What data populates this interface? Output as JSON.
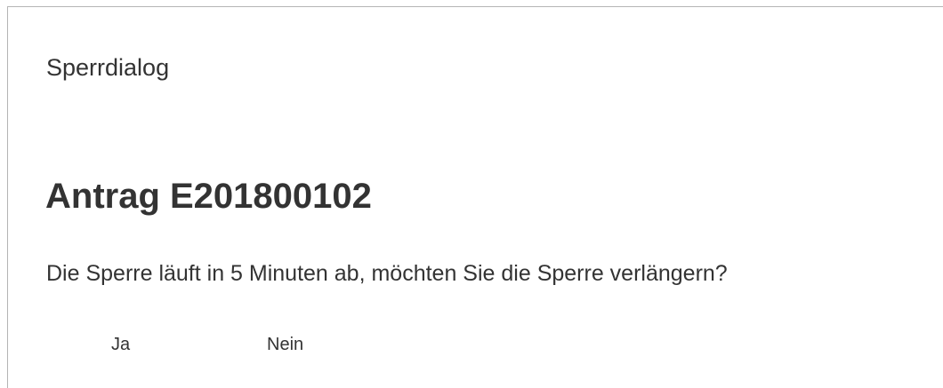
{
  "dialog": {
    "title": "Sperrdialog",
    "record_heading": "Antrag E201800102",
    "question": "Die Sperre läuft in 5 Minuten ab, möchten Sie die Sperre verlängern?",
    "buttons": {
      "yes_label": "Ja",
      "no_label": "Nein"
    }
  }
}
